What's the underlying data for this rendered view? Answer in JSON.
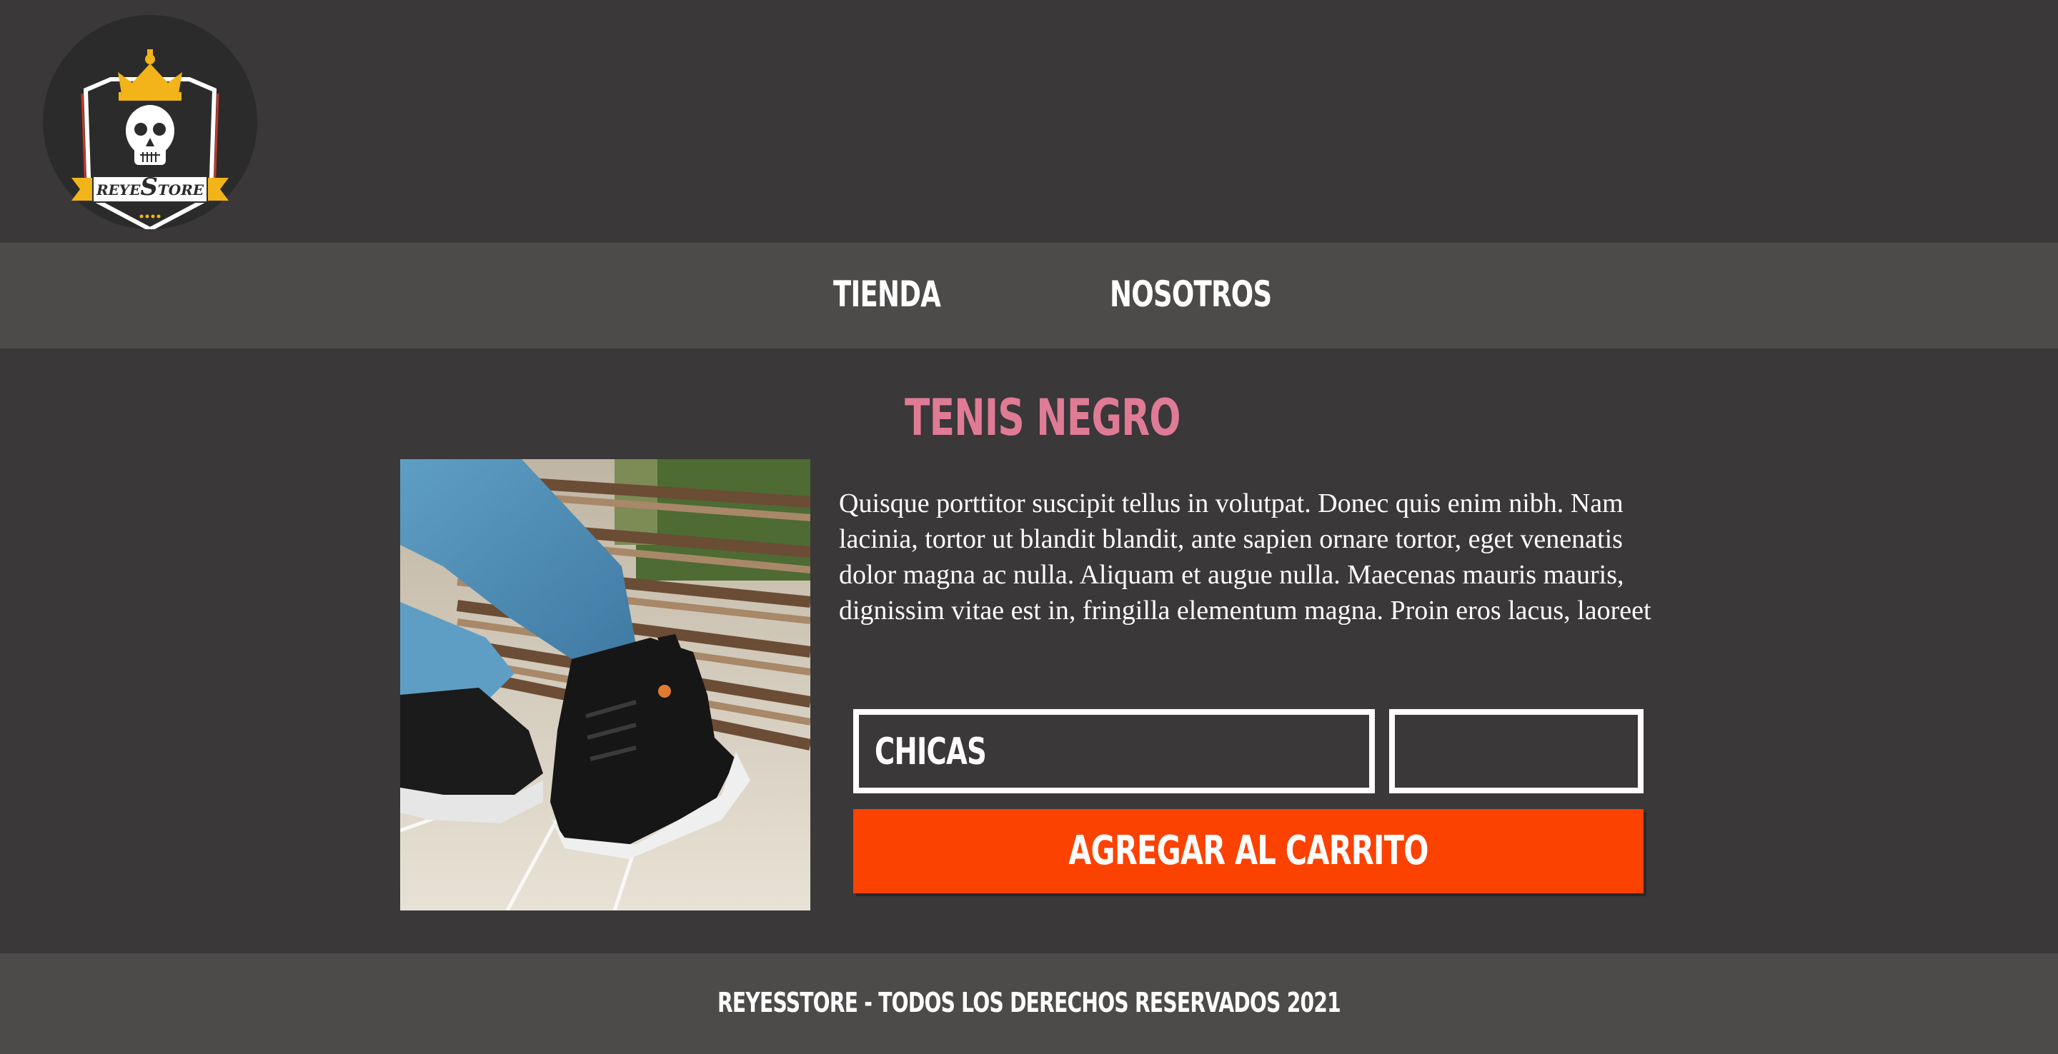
{
  "header": {
    "logo": {
      "text_left": "REYE",
      "text_mid": "S",
      "text_right": "TORE",
      "icon": "skull-crown-icon"
    }
  },
  "nav": {
    "items": [
      {
        "label": "TIENDA"
      },
      {
        "label": "NOSOTROS"
      }
    ]
  },
  "product": {
    "title": "TENIS NEGRO",
    "image": {
      "icon": "sneaker-photo"
    },
    "description": "Quisque porttitor suscipit tellus in volutpat. Donec quis enim nibh. Nam lacinia, tortor ut blandit blandit, ante sapien ornare tortor, eget venenatis dolor magna ac nulla. Aliquam et augue nulla. Maecenas mauris mauris, dignissim vitae est in, fringilla elementum magna. Proin eros lacus, laoreet",
    "size_select": {
      "value": "CHICAS"
    },
    "quantity": {
      "value": ""
    },
    "add_to_cart_label": "AGREGAR AL CARRITO"
  },
  "footer": {
    "text": "REYESSTORE - TODOS LOS DERECHOS RESERVADOS 2021"
  },
  "colors": {
    "background": "#3a3839",
    "bar": "#4c4b49",
    "title_pink": "#e07b95",
    "cta_orange": "#fc4200",
    "logo_gold": "#f2b418"
  }
}
